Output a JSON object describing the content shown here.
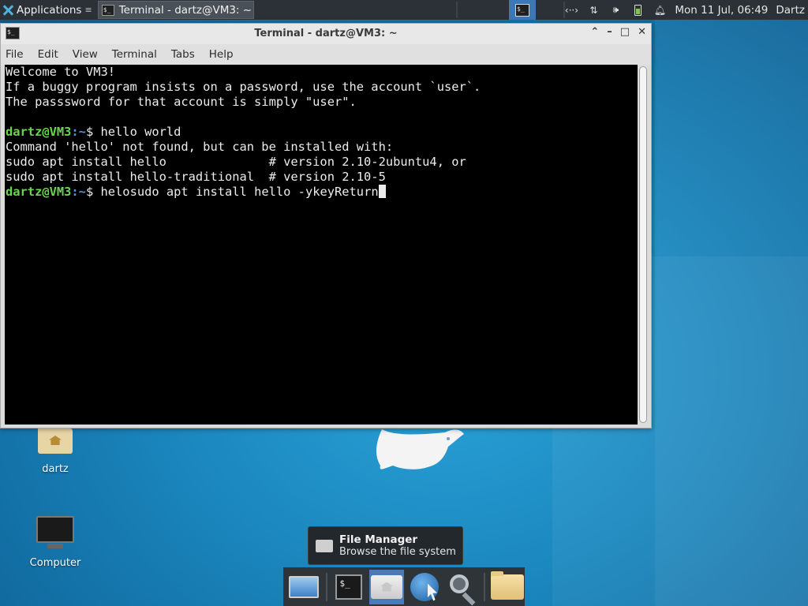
{
  "top_panel": {
    "applications_label": "Applications",
    "applications_more": "≡",
    "task_title": "Terminal - dartz@VM3: ~",
    "tray_icons": [
      "network-icon",
      "updown-icon",
      "volume-icon",
      "battery-icon",
      "notification-bell-icon"
    ],
    "clock": "Mon 11 Jul, 06:49",
    "user": "Dartz"
  },
  "terminal_window": {
    "title": "Terminal - dartz@VM3: ~",
    "menu": [
      "File",
      "Edit",
      "View",
      "Terminal",
      "Tabs",
      "Help"
    ],
    "lines": [
      {
        "type": "text",
        "text": "Welcome to VM3!"
      },
      {
        "type": "text",
        "text": "If a buggy program insists on a password, use the account `user`."
      },
      {
        "type": "text",
        "text": "The passsword for that account is simply \"user\"."
      },
      {
        "type": "text",
        "text": ""
      },
      {
        "type": "prompt",
        "user": "dartz@VM3",
        "path": ":~",
        "symbol": "$ ",
        "command": "hello world"
      },
      {
        "type": "text",
        "text": "Command 'hello' not found, but can be installed with:"
      },
      {
        "type": "text",
        "text": "sudo apt install hello              # version 2.10-2ubuntu4, or"
      },
      {
        "type": "text",
        "text": "sudo apt install hello-traditional  # version 2.10-5"
      },
      {
        "type": "prompt",
        "user": "dartz@VM3",
        "path": ":~",
        "symbol": "$ ",
        "command": "helosudo apt install hello -ykeyReturn",
        "cursor": true
      }
    ],
    "colors": {
      "prompt_user": "#68d64c",
      "prompt_path": "#5c8fe0",
      "background": "#000000",
      "text": "#ececec"
    }
  },
  "desktop": {
    "icons": [
      {
        "name": "home-folder",
        "label": "dartz"
      },
      {
        "name": "computer",
        "label": "Computer"
      }
    ]
  },
  "tooltip": {
    "title": "File Manager",
    "subtitle": "Browse the file system"
  },
  "dock": {
    "items": [
      "show-desktop",
      "terminal",
      "file-manager",
      "web-browser",
      "app-finder",
      "folder"
    ],
    "active": "file-manager"
  }
}
